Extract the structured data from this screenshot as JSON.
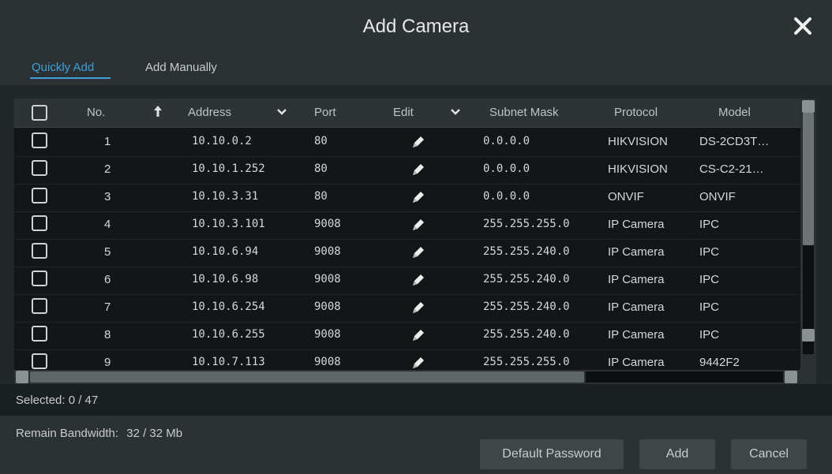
{
  "dialog": {
    "title": "Add Camera",
    "tabs": [
      {
        "label": "Quickly Add",
        "active": true
      },
      {
        "label": "Add Manually",
        "active": false
      }
    ]
  },
  "table": {
    "columns": [
      "No.",
      "Address",
      "Port",
      "Edit",
      "Subnet Mask",
      "Protocol",
      "Model"
    ],
    "rows": [
      {
        "no": "1",
        "address": "10.10.0.2",
        "port": "80",
        "subnet": "0.0.0.0",
        "protocol": "HIKVISION",
        "model": "DS-2CD3T…"
      },
      {
        "no": "2",
        "address": "10.10.1.252",
        "port": "80",
        "subnet": "0.0.0.0",
        "protocol": "HIKVISION",
        "model": "CS-C2-21…"
      },
      {
        "no": "3",
        "address": "10.10.3.31",
        "port": "80",
        "subnet": "0.0.0.0",
        "protocol": "ONVIF",
        "model": "ONVIF"
      },
      {
        "no": "4",
        "address": "10.10.3.101",
        "port": "9008",
        "subnet": "255.255.255.0",
        "protocol": "IP Camera",
        "model": "IPC"
      },
      {
        "no": "5",
        "address": "10.10.6.94",
        "port": "9008",
        "subnet": "255.255.240.0",
        "protocol": "IP Camera",
        "model": "IPC"
      },
      {
        "no": "6",
        "address": "10.10.6.98",
        "port": "9008",
        "subnet": "255.255.240.0",
        "protocol": "IP Camera",
        "model": "IPC"
      },
      {
        "no": "7",
        "address": "10.10.6.254",
        "port": "9008",
        "subnet": "255.255.240.0",
        "protocol": "IP Camera",
        "model": "IPC"
      },
      {
        "no": "8",
        "address": "10.10.6.255",
        "port": "9008",
        "subnet": "255.255.240.0",
        "protocol": "IP Camera",
        "model": "IPC"
      },
      {
        "no": "9",
        "address": "10.10.7.113",
        "port": "9008",
        "subnet": "255.255.255.0",
        "protocol": "IP Camera",
        "model": "9442F2"
      }
    ]
  },
  "status": {
    "selected_label": "Selected: 0 / 47",
    "bandwidth_label": "Remain Bandwidth:",
    "bandwidth_value": "32 / 32 Mb"
  },
  "buttons": {
    "default_password": "Default Password",
    "add": "Add",
    "cancel": "Cancel"
  },
  "colors": {
    "accent": "#3e9fdc",
    "background": "#222829",
    "table_bg": "#121617"
  },
  "icons": [
    "close-icon",
    "sort-up-arrow-icon",
    "chevron-down-icon",
    "edit-pencil-icon",
    "checkbox-icon"
  ]
}
